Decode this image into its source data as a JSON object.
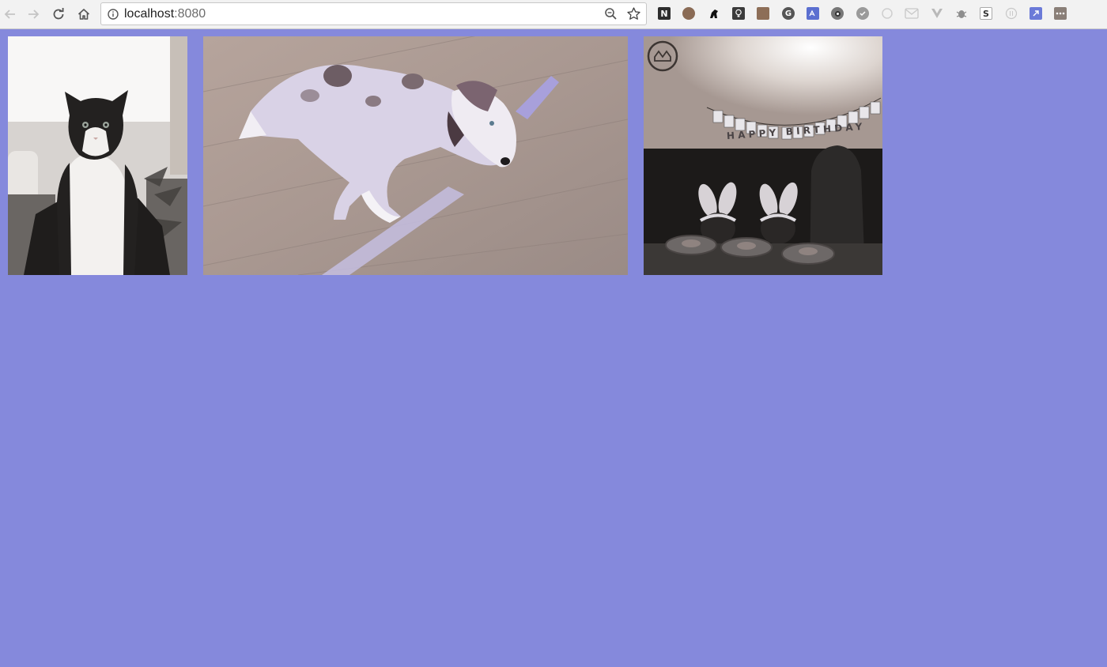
{
  "browser": {
    "url_host": "localhost",
    "url_port": ":8080"
  },
  "toolbar_icons": [
    "back-icon",
    "forward-icon",
    "reload-icon",
    "home-icon",
    "info-icon",
    "zoom-icon",
    "bookmark-star-icon"
  ],
  "extensions": [
    {
      "name": "notion-extension-icon",
      "letter": "N"
    },
    {
      "name": "cookie-extension-icon",
      "letter": ""
    },
    {
      "name": "dog-extension-icon",
      "letter": ""
    },
    {
      "name": "lightbulb-extension-icon",
      "letter": ""
    },
    {
      "name": "book-extension-icon",
      "letter": ""
    },
    {
      "name": "grammarly-extension-icon",
      "letter": "G"
    },
    {
      "name": "translate-extension-icon",
      "letter": ""
    },
    {
      "name": "eye-extension-icon",
      "letter": ""
    },
    {
      "name": "check-extension-icon",
      "letter": ""
    },
    {
      "name": "sync-extension-icon",
      "letter": ""
    },
    {
      "name": "mail-extension-icon",
      "letter": ""
    },
    {
      "name": "vue-extension-icon",
      "letter": ""
    },
    {
      "name": "bug-extension-icon",
      "letter": ""
    },
    {
      "name": "s-extension-icon",
      "letter": "S"
    },
    {
      "name": "json-extension-icon",
      "letter": ""
    },
    {
      "name": "arrow-extension-icon",
      "letter": ""
    },
    {
      "name": "more-extension-icon",
      "letter": ""
    }
  ],
  "colors": {
    "page_background": "#8589dc",
    "toolbar_background": "#f2f2f2"
  },
  "gallery": {
    "photos": [
      {
        "name": "cat-photo",
        "subject": "tuxedo cat sitting"
      },
      {
        "name": "dog-photo",
        "subject": "puppy lying on wooden floor"
      },
      {
        "name": "birthday-photo",
        "subject": "bunny ears and HAPPY BIRTHDAY banner"
      }
    ],
    "banner_text": "HAPPY BIRTHDAY"
  }
}
